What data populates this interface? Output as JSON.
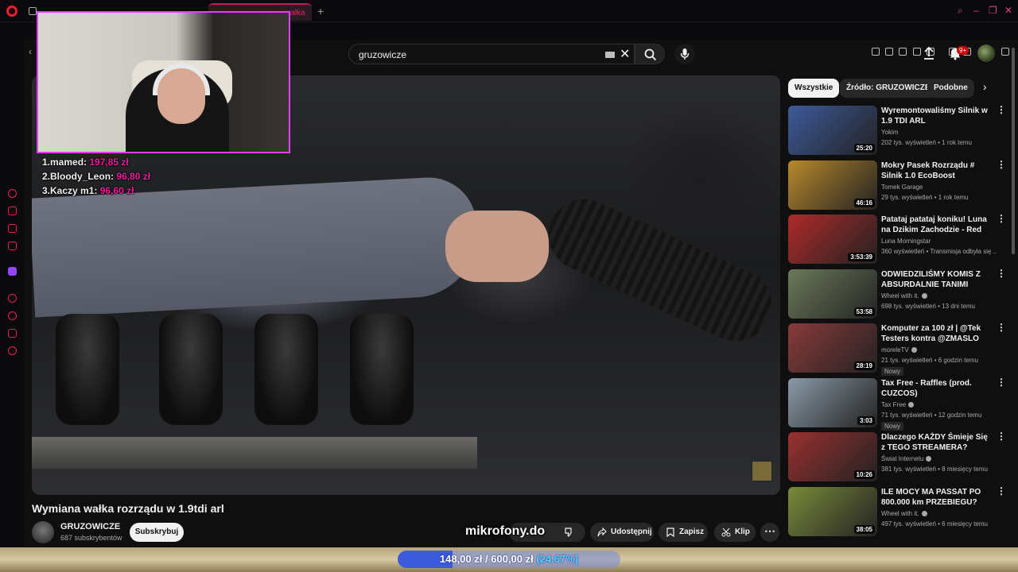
{
  "browser": {
    "tab_title": "wałka",
    "new_tab": "+",
    "ai_label": "AI"
  },
  "search": {
    "query": "gruzowicze"
  },
  "notifications": {
    "badge": "9+"
  },
  "overlay": {
    "donors": [
      {
        "rank": "1.",
        "name": "mamed:",
        "amount": "197,85 zł"
      },
      {
        "rank": "2.",
        "name": "Bloody_Leon:",
        "amount": "96,80 zł"
      },
      {
        "rank": "3.",
        "name": "Kaczy m1:",
        "amount": "96,60 zł"
      }
    ],
    "sponsor": "mikrofony.do",
    "goal": {
      "current": "148,00 zł",
      "separator": "/",
      "target": "600,00 zł",
      "percent_label": "(24.67%)",
      "fraction": 0.2467
    }
  },
  "video": {
    "title": "Wymiana wałka rozrządu w 1.9tdi arl",
    "channel": "GRUZOWICZE",
    "subscribers": "687 subskrybentów",
    "subscribe_label": "Subskrybuj",
    "share_label": "Udostępnij",
    "save_label": "Zapisz",
    "clip_label": "Klip",
    "more_label": "⋯"
  },
  "chips": [
    {
      "label": "Wszystkie",
      "active": true
    },
    {
      "label": "Źródło: GRUZOWICZE",
      "active": false
    },
    {
      "label": "Podobne",
      "active": false
    }
  ],
  "recommendations": [
    {
      "title": "Wyremontowaliśmy Silnik w 1.9 TDI ARL",
      "channel": "Yokim",
      "verified": false,
      "meta": "202 tys. wyświetleń • 1 rok temu",
      "duration": "25:20",
      "badge": "",
      "thumb_color": "#3d5a9a"
    },
    {
      "title": "Mokry Pasek Rozrządu # Silnik 1.0 EcoBoost",
      "channel": "Tomek Garage",
      "verified": false,
      "meta": "29 tys. wyświetleń • 1 rok temu",
      "duration": "46:16",
      "badge": "",
      "thumb_color": "#b8892c"
    },
    {
      "title": "Patataj patataj koniku! Luna na Dzikim Zachodzie - Red Dead ...",
      "channel": "Luna Morningstar",
      "verified": false,
      "meta": "360 wyświetleń • Transmisja odbyła się ...",
      "duration": "3:53:39",
      "badge": "",
      "thumb_color": "#b02a2a"
    },
    {
      "title": "ODWIEDZILIŚMY KOMIS Z ABSURDALNIE TANIMI AUTAMI",
      "channel": "Wheel with it.",
      "verified": true,
      "meta": "698 tys. wyświetleń • 13 dni temu",
      "duration": "53:58",
      "badge": "",
      "thumb_color": "#6c7a5a"
    },
    {
      "title": "Komputer za 100 zł | @Tek Testers kontra @ZMASLO",
      "channel": "moreleTV",
      "verified": true,
      "meta": "21 tys. wyświetleń • 6 godzin temu",
      "duration": "28:19",
      "badge": "Nowy",
      "thumb_color": "#8a3a3a"
    },
    {
      "title": "Tax Free - Raffles (prod. CUZCOS)",
      "channel": "Tax Free",
      "verified": true,
      "meta": "71 tys. wyświetleń • 12 godzin temu",
      "duration": "3:03",
      "badge": "Nowy",
      "thumb_color": "#8a9aa8"
    },
    {
      "title": "Dlaczego KAŻDY Śmieje Się z TEGO STREAMERA?",
      "channel": "Świat Internetu",
      "verified": true,
      "meta": "381 tys. wyświetleń • 8 miesięcy temu",
      "duration": "10:26",
      "badge": "",
      "thumb_color": "#9a3030"
    },
    {
      "title": "ILE MOCY MA PASSAT PO 800.000 km PRZEBIEGU?",
      "channel": "Wheel with it.",
      "verified": true,
      "meta": "497 tys. wyświetleń • 6 miesięcy temu",
      "duration": "38:05",
      "badge": "",
      "thumb_color": "#7a8a3a"
    }
  ]
}
